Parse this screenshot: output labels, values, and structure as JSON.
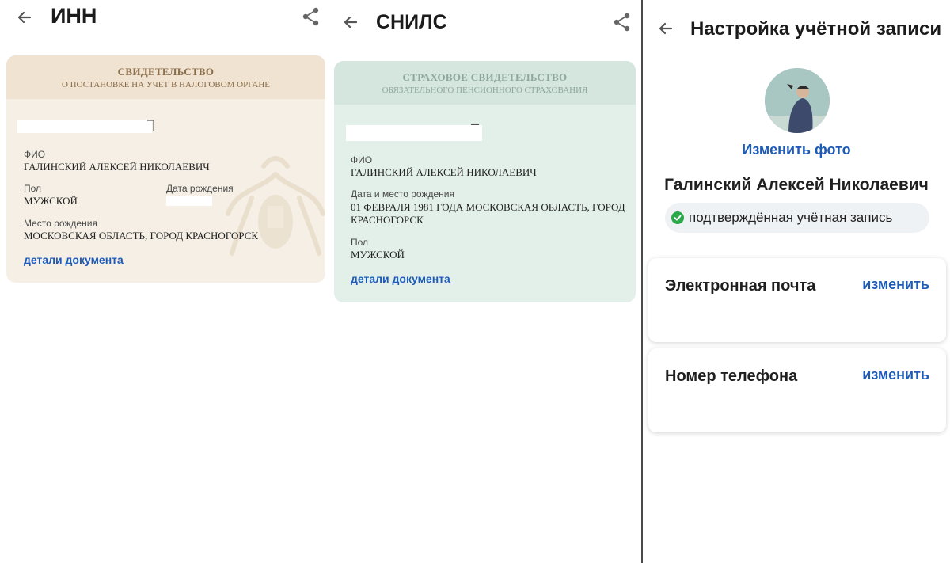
{
  "inn_screen": {
    "title": "ИНН",
    "card": {
      "heading": "СВИДЕТЕЛЬСТВО",
      "subheading": "О ПОСТАНОВКЕ НА УЧЕТ В НАЛОГОВОМ ОРГАНЕ",
      "fio_label": "ФИО",
      "fio_value": "ГАЛИНСКИЙ АЛЕКСЕЙ НИКОЛАЕВИЧ",
      "sex_label": "Пол",
      "sex_value": "МУЖСКОЙ",
      "birthdate_label": "Дата рождения",
      "birthplace_label": "Место рождения",
      "birthplace_value": "МОСКОВСКАЯ ОБЛАСТЬ, ГОРОД КРАСНОГОРСК",
      "details_link": "детали документа"
    }
  },
  "snils_screen": {
    "title": "СНИЛС",
    "card": {
      "heading": "СТРАХОВОЕ СВИДЕТЕЛЬСТВО",
      "subheading": "ОБЯЗАТЕЛЬНОГО ПЕНСИОННОГО СТРАХОВАНИЯ",
      "fio_label": "ФИО",
      "fio_value": "ГАЛИНСКИЙ АЛЕКСЕЙ НИКОЛАЕВИЧ",
      "birth_label": "Дата и место рождения",
      "birth_value_line1": "01 ФЕВРАЛЯ 1981 ГОДА МОСКОВСКАЯ ОБЛАСТЬ, ГОРОД",
      "birth_value_line2": "КРАСНОГОРСК",
      "sex_label": "Пол",
      "sex_value": "МУЖСКОЙ",
      "details_link": "детали документа"
    }
  },
  "account_screen": {
    "title": "Настройка учётной записи",
    "change_photo": "Изменить фото",
    "full_name": "Галинский Алексей Николаевич",
    "verified_status": "подтверждённая учётная запись",
    "email": {
      "title": "Электронная почта",
      "action": "изменить"
    },
    "phone": {
      "title": "Номер телефона",
      "action": "изменить"
    }
  },
  "colors": {
    "accent_blue": "#1e5bb8",
    "inn_card_bg": "#f5efe5",
    "snils_card_bg": "#e3f0ea",
    "verified_green": "#2aa84a"
  }
}
